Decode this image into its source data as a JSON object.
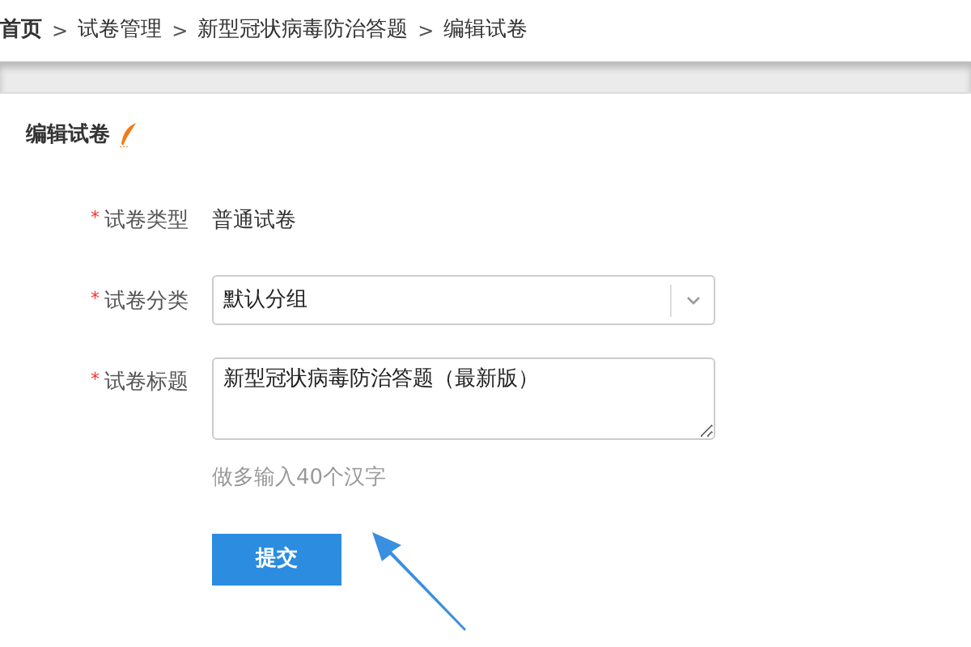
{
  "breadcrumb": [
    {
      "label": "首页",
      "kind": "link",
      "bold": true
    },
    {
      "label": ">",
      "kind": "separator"
    },
    {
      "label": "试卷管理",
      "kind": "link",
      "bold": false
    },
    {
      "label": ">",
      "kind": "separator"
    },
    {
      "label": "新型冠状病毒防治答题",
      "kind": "link",
      "bold": false
    },
    {
      "label": ">",
      "kind": "separator"
    },
    {
      "label": "编辑试卷",
      "kind": "link",
      "bold": false
    }
  ],
  "section_title": "编辑试卷",
  "fields": [
    {
      "kind": "static",
      "required_mark": "*",
      "label": "试卷类型",
      "value": "普通试卷"
    },
    {
      "kind": "select",
      "required_mark": "*",
      "label": "试卷分类",
      "value": "默认分组"
    },
    {
      "kind": "textarea",
      "required_mark": "*",
      "label": "试卷标题",
      "value": "新型冠状病毒防治答题（最新版）",
      "hint": "做多输入40个汉字"
    }
  ],
  "submit_button": "提交"
}
